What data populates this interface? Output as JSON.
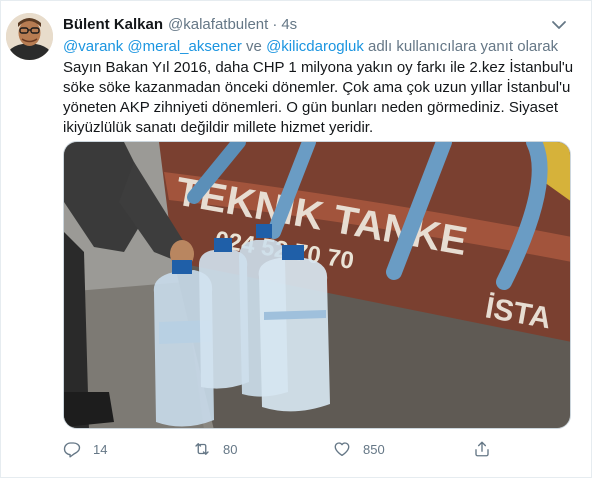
{
  "tweet": {
    "author_name": "Bülent Kalkan",
    "author_handle": "@kalafatbulent",
    "separator": "·",
    "time": "4s",
    "reply_to": {
      "mentions": [
        "@varank",
        "@meral_aksener",
        "@kilicdarogluk"
      ],
      "connector": "ve",
      "suffix": "adlı kullanıcılara yanıt olarak"
    },
    "text_lines": [
      "Sayın Bakan Yıl 2016, daha CHP 1 milyona yakın oy farkı ile 2.kez İstanbul'u",
      "söke söke kazanmadan önceki dönemler. Çok ama çok uzun yıllar İstanbul'u",
      "yöneten AKP zihniyeti dönemleri. O gün bunları neden görmediniz. Siyaset",
      "ikiyüzlülük sanatı değildir millete hizmet yeridir."
    ],
    "media": {
      "truck_text_top": "TEKNİK TANKE",
      "truck_phone": "024 52 70 70",
      "truck_text_bottom": "İSTA"
    },
    "actions": {
      "reply_count": "14",
      "retweet_count": "80",
      "like_count": "850"
    }
  },
  "icons": {
    "caret": "chevron-down-icon",
    "reply": "reply-icon",
    "retweet": "retweet-icon",
    "like": "heart-icon",
    "share": "share-icon"
  },
  "colors": {
    "link": "#1b95e0",
    "secondary": "#657786",
    "text": "#14171a"
  }
}
